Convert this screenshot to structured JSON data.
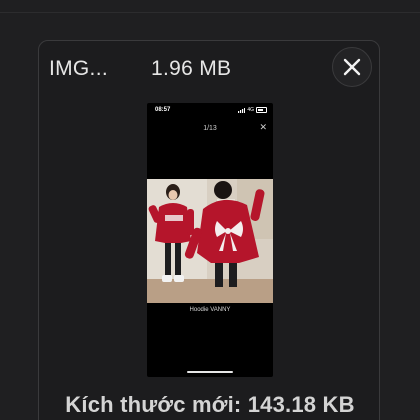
{
  "file": {
    "name": "IMG...",
    "size": "1.96 MB"
  },
  "close_icon": "close-icon",
  "preview": {
    "status_time": "08:57",
    "status_signal": "4G",
    "page_indicator": "1/13",
    "caption": "Hoodie VANNY"
  },
  "result": {
    "new_size": "Kích thước mới: 143.18 KB"
  },
  "colors": {
    "background": "#1f1f21",
    "card_border": "#3a3a3c",
    "text": "#e6e6e6",
    "hoodie_red": "#b5152b"
  }
}
